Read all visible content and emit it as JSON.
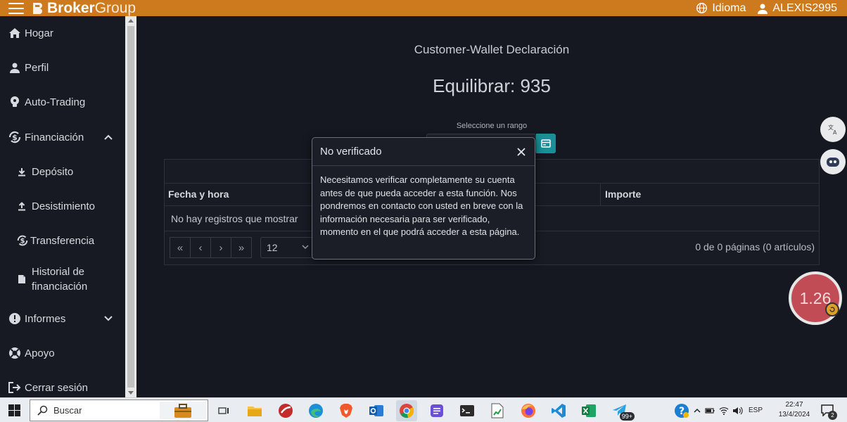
{
  "header": {
    "brand_bold": "Broker",
    "brand_light": "Group",
    "language": "Idioma",
    "username": "ALEXIS2995",
    "colors": {
      "bar": "#cd7a1f"
    }
  },
  "sidebar": {
    "items": [
      {
        "label": "Hogar",
        "icon": "home-icon"
      },
      {
        "label": "Perfil",
        "icon": "user-icon"
      },
      {
        "label": "Auto-Trading",
        "icon": "bulb-icon"
      },
      {
        "label": "Financiación",
        "icon": "dollar-sync-icon",
        "expanded": true
      },
      {
        "label": "Depósito",
        "icon": "download-icon"
      },
      {
        "label": "Desistimiento",
        "icon": "upload-icon"
      },
      {
        "label": "Transferencia",
        "icon": "dollar-sync-icon"
      },
      {
        "label_line1": "Historial de",
        "label_line2": "financiación",
        "icon": "file-icon"
      },
      {
        "label": "Informes",
        "icon": "info-icon",
        "expanded": false
      },
      {
        "label": "Apoyo",
        "icon": "lifebuoy-icon"
      },
      {
        "label": "Cerrar sesión",
        "icon": "logout-icon"
      }
    ]
  },
  "main": {
    "title": "Customer-Wallet Declaración",
    "balance": "Equilibrar: 935",
    "range_label": "Seleccione un rango",
    "table": {
      "columns": [
        "Fecha y hora",
        "Importe"
      ],
      "empty_message": "No hay registros que mostrar",
      "pager": [
        "«",
        "‹",
        "›",
        "»"
      ],
      "per_page": "12",
      "page_info": "0 de 0 páginas (0 artículos)"
    }
  },
  "modal": {
    "title": "No verificado",
    "body": "Necesitamos verificar completamente su cuenta antes de que pueda acceder a esta función. Nos pondremos en contacto con usted en breve con la información necesaria para ser verificado, momento en el que podrá acceder a esta página."
  },
  "floating": {
    "gauge_value": "1.26"
  },
  "taskbar": {
    "search_label": "Buscar",
    "badge": "99+",
    "language": "ESP",
    "time": "22:47",
    "date": "13/4/2024",
    "notification_count": "2"
  }
}
